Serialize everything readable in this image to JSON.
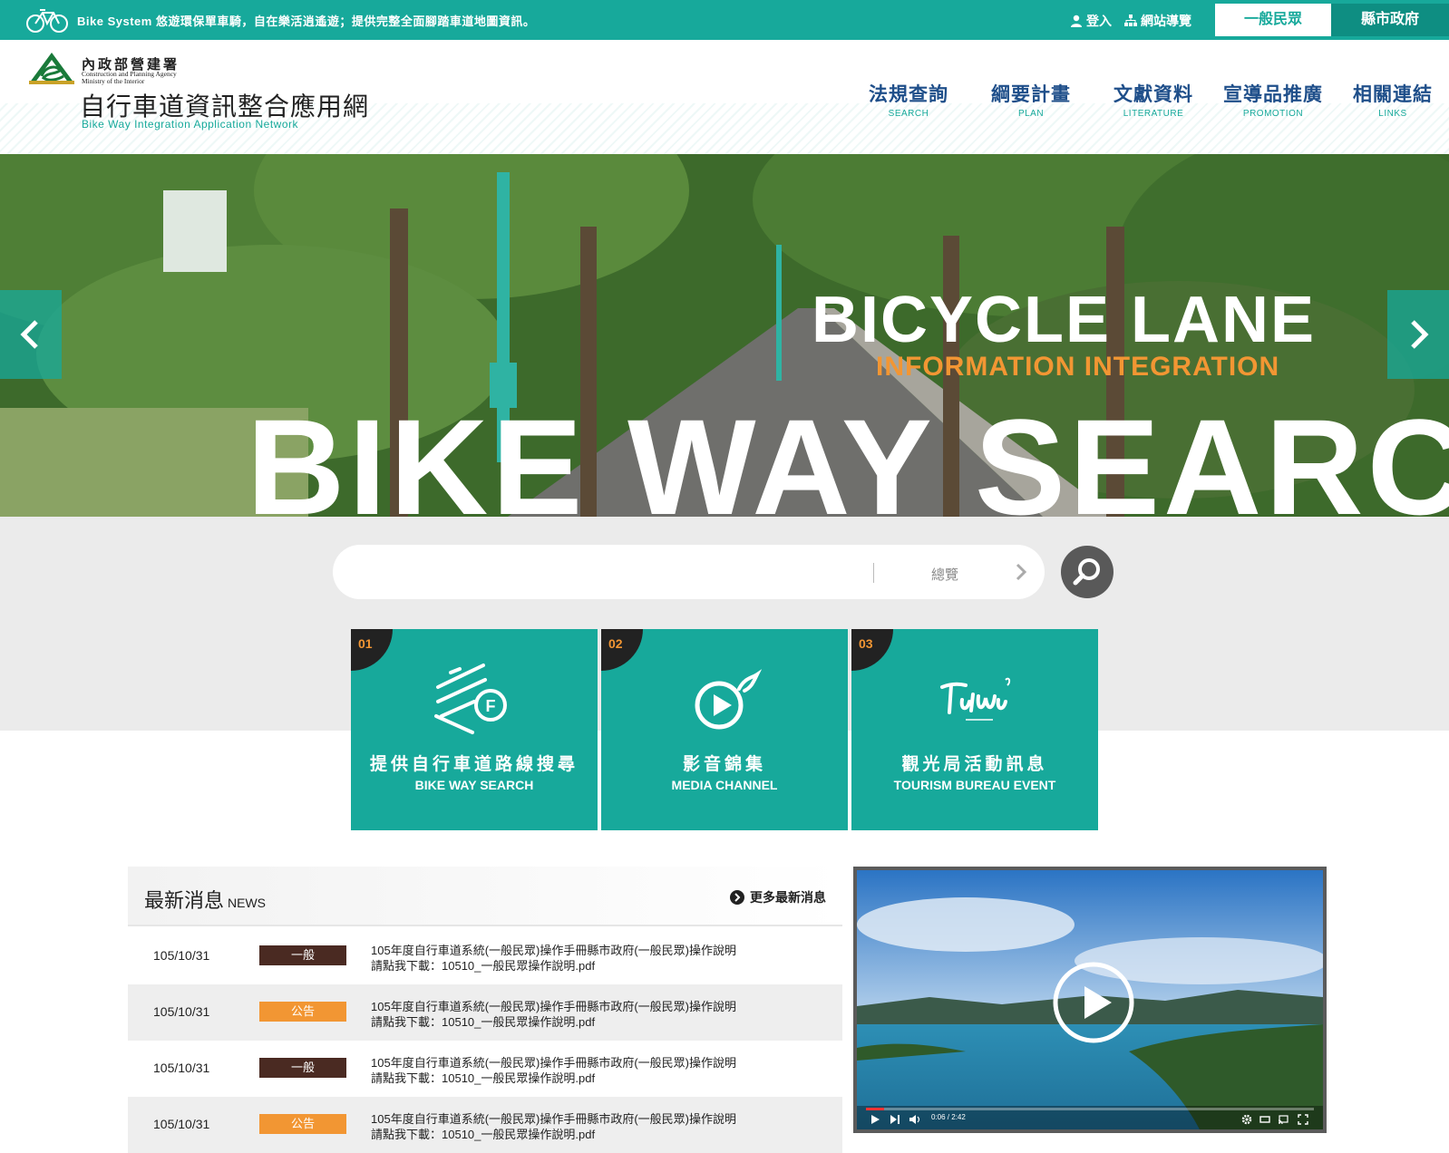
{
  "topbar": {
    "slogan": "Bike System 悠遊環保單車騎，自在樂活逍遙遊；提供完整全面腳踏車道地圖資訊。",
    "login": "登入",
    "sitemap": "網站導覽",
    "tab_public": "一般民眾",
    "tab_gov": "縣市政府"
  },
  "header": {
    "agency_zh": "內政部營建署",
    "agency_en_1": "Construction and Planning Agency",
    "agency_en_2": "Ministry of the Interior",
    "site_title": "自行車道資訊整合應用網",
    "site_title_en": "Bike Way Integration Application Network",
    "nav": [
      {
        "zh": "法規查詢",
        "en": "SEARCH"
      },
      {
        "zh": "綱要計畫",
        "en": "PLAN"
      },
      {
        "zh": "文獻資料",
        "en": "LITERATURE"
      },
      {
        "zh": "宣導品推廣",
        "en": "PROMOTION"
      },
      {
        "zh": "相關連結",
        "en": "LINKS"
      }
    ]
  },
  "hero": {
    "line1": "BICYCLE LANE",
    "line2": "INFORMATION INTEGRATION",
    "line3": "BIKE WAY SEARCH"
  },
  "search": {
    "value": "",
    "placeholder": "",
    "overview": "總覽"
  },
  "tiles": [
    {
      "num": "01",
      "zh": "提供自行車道路線搜尋",
      "en": "BIKE WAY SEARCH",
      "icon": "bike-way-search-icon"
    },
    {
      "num": "02",
      "zh": "影音錦集",
      "en": "MEDIA CHANNEL",
      "icon": "media-play-icon"
    },
    {
      "num": "03",
      "zh": "觀光局活動訊息",
      "en": "TOURISM BUREAU EVENT",
      "icon": "taiwan-tourism-logo"
    }
  ],
  "news": {
    "title_zh": "最新消息",
    "title_en": "NEWS",
    "more": "更多最新消息",
    "rows": [
      {
        "date": "105/10/31",
        "badge": "一般",
        "type": "general",
        "line1": "105年度自行車道系統(一般民眾)操作手冊縣市政府(一般民眾)操作說明",
        "line2": "請點我下載：10510_一般民眾操作說明.pdf"
      },
      {
        "date": "105/10/31",
        "badge": "公告",
        "type": "notice",
        "line1": "105年度自行車道系統(一般民眾)操作手冊縣市政府(一般民眾)操作說明",
        "line2": "請點我下載：10510_一般民眾操作說明.pdf"
      },
      {
        "date": "105/10/31",
        "badge": "一般",
        "type": "general",
        "line1": "105年度自行車道系統(一般民眾)操作手冊縣市政府(一般民眾)操作說明",
        "line2": "請點我下載：10510_一般民眾操作說明.pdf"
      },
      {
        "date": "105/10/31",
        "badge": "公告",
        "type": "notice",
        "line1": "105年度自行車道系統(一般民眾)操作手冊縣市政府(一般民眾)操作說明",
        "line2": "請點我下載：10510_一般民眾操作說明.pdf"
      }
    ]
  },
  "video": {
    "time": "0:06 / 2:42",
    "progress": 0.04
  },
  "colors": {
    "brand_teal": "#17a99b",
    "nav_blue": "#1f4f8a",
    "accent_orange": "#f29633",
    "badge_brown": "#4a2a22"
  }
}
